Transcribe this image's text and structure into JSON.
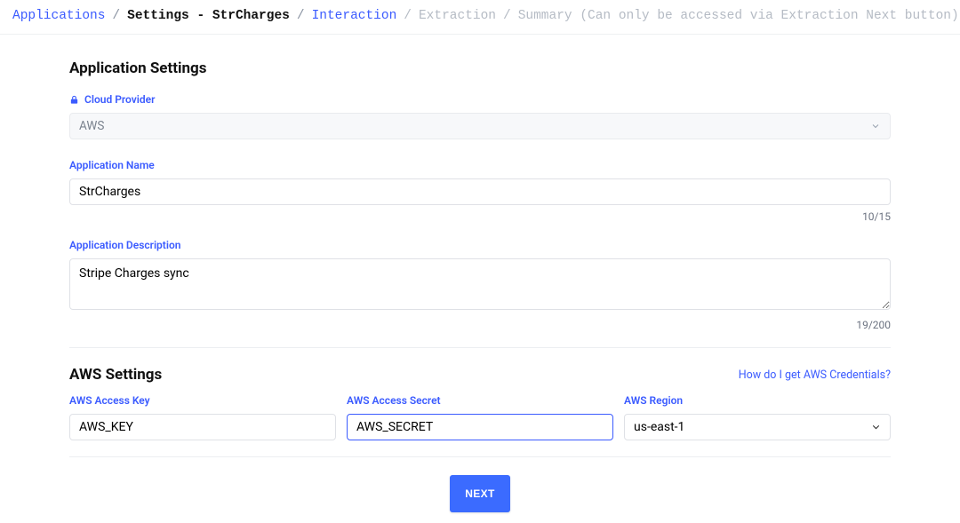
{
  "breadcrumb": {
    "applications": "Applications",
    "settings": "Settings - StrCharges",
    "interaction": "Interaction",
    "extraction": "Extraction",
    "summary": "Summary (Can only be accessed via Extraction Next button)"
  },
  "app_settings": {
    "title": "Application Settings",
    "cloud_provider_label": "Cloud Provider",
    "cloud_provider_value": "AWS",
    "app_name_label": "Application Name",
    "app_name_value": "StrCharges",
    "app_name_counter": "10/15",
    "app_desc_label": "Application Description",
    "app_desc_value": "Stripe Charges sync",
    "app_desc_counter": "19/200"
  },
  "aws_settings": {
    "title": "AWS Settings",
    "help_link": "How do I get AWS Credentials?",
    "access_key_label": "AWS Access Key",
    "access_key_value": "AWS_KEY",
    "access_secret_label": "AWS Access Secret",
    "access_secret_value": "AWS_SECRET",
    "region_label": "AWS Region",
    "region_value": "us-east-1"
  },
  "next_button": "NEXT"
}
